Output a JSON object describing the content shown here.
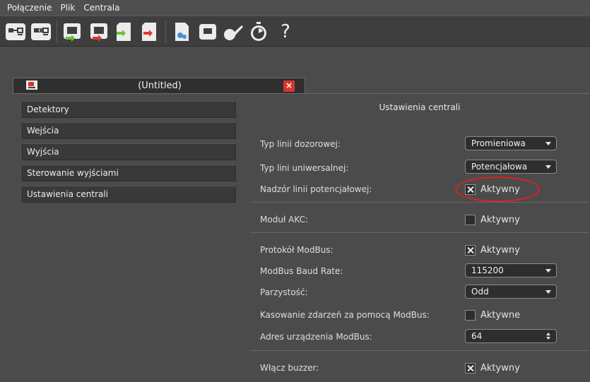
{
  "menu": {
    "items": [
      "Połączenie",
      "Plik",
      "Centrala"
    ]
  },
  "toolbar": {
    "buttons": [
      "connect-icon",
      "disconnect-icon",
      "read-from-device-icon",
      "write-to-device-icon",
      "import-icon",
      "export-icon",
      "document-icon",
      "device-icon",
      "calibrate-icon",
      "timer-icon",
      "help-icon"
    ],
    "help_label": "?"
  },
  "tab": {
    "title": "(Untitled)",
    "close_label": "×"
  },
  "nav": {
    "items": [
      "Detektory",
      "Wejścia",
      "Wyjścia",
      "Sterowanie wyjściami",
      "Ustawienia centrali"
    ]
  },
  "panel": {
    "title": "Ustawienia centrali",
    "typ_linii_dozorowej": {
      "label": "Typ linii dozorowej:",
      "value": "Promieniowa"
    },
    "typ_lini_uniwersalnej": {
      "label": "Typ lini uniwersalnej:",
      "value": "Potencjałowa"
    },
    "nadzor_linii": {
      "label": "Nadzór linii potencjałowej:",
      "check_label": "Aktywny",
      "checked": true
    },
    "modul_akc": {
      "label": "Moduł AKC:",
      "check_label": "Aktywny",
      "checked": false
    },
    "protokol_modbus": {
      "label": "Protokół ModBus:",
      "check_label": "Aktywny",
      "checked": true
    },
    "modbus_baud": {
      "label": "ModBus Baud Rate:",
      "value": "115200"
    },
    "parzystosc": {
      "label": "Parzystość:",
      "value": "Odd"
    },
    "kasowanie": {
      "label": "Kasowanie zdarzeń za pomocą ModBus:",
      "check_label": "Aktywne",
      "checked": false
    },
    "adres": {
      "label": "Adres urządzenia ModBus:",
      "value": "64"
    },
    "buzzer": {
      "label": "Włącz buzzer:",
      "check_label": "Aktywny",
      "checked": true
    }
  },
  "colors": {
    "background": "#4b4b4b",
    "toolbar": "#3e3e3e",
    "accent_red": "#d9342b",
    "highlight": "#e0201c",
    "arrow_green": "#6cc23a"
  }
}
